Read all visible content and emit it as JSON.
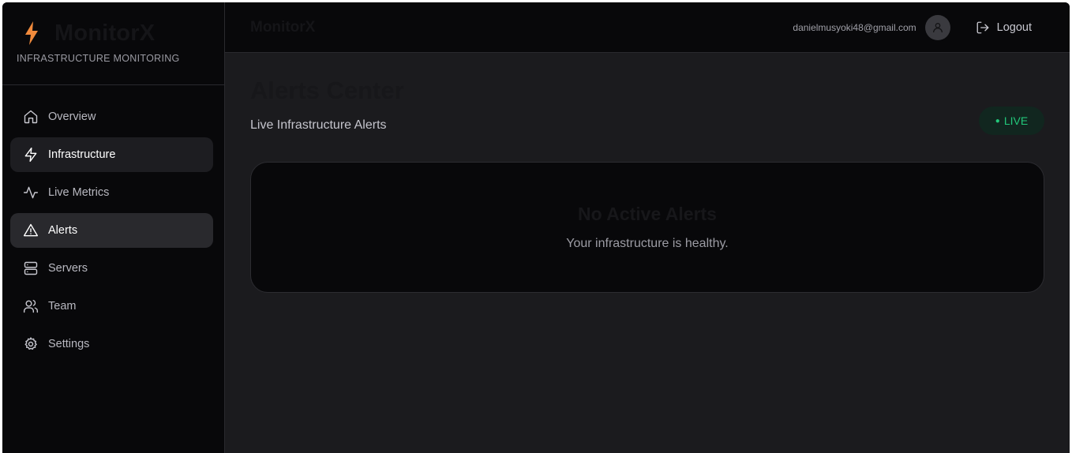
{
  "brand": {
    "title": "MonitorX",
    "subtitle": "INFRASTRUCTURE MONITORING",
    "icon": "bolt-icon",
    "accent": "#f08a3c"
  },
  "sidebar": {
    "items": [
      {
        "label": "Overview",
        "icon": "home-icon"
      },
      {
        "label": "Infrastructure",
        "icon": "bolt-icon"
      },
      {
        "label": "Live Metrics",
        "icon": "activity-icon"
      },
      {
        "label": "Alerts",
        "icon": "alert-triangle-icon"
      },
      {
        "label": "Servers",
        "icon": "server-icon"
      },
      {
        "label": "Team",
        "icon": "users-icon"
      },
      {
        "label": "Settings",
        "icon": "gear-icon"
      }
    ],
    "active": "Alerts"
  },
  "header": {
    "title": "MonitorX",
    "user_email": "danielmusyoki48@gmail.com",
    "logout_label": "Logout"
  },
  "page": {
    "title": "Alerts Center",
    "subtitle": "Live Infrastructure Alerts",
    "live_label": "LIVE",
    "live_color": "#22c77a"
  },
  "alerts_panel": {
    "title": "No Active Alerts",
    "message": "Your infrastructure is healthy."
  }
}
